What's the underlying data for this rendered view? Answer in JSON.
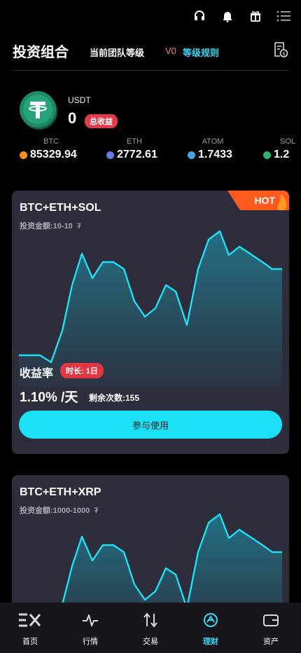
{
  "colors": {
    "accent": "#1ce1f6",
    "badge": "#e23a4b",
    "level_value": "#f08a4b",
    "level_rule": "#38d8f3",
    "card_bg": "#2d2d3b",
    "hot": "#ff5a1e"
  },
  "topbar": {
    "icons": [
      "headset-icon",
      "bell-icon",
      "gift-icon",
      "menu-icon"
    ]
  },
  "header": {
    "title": "投资组合",
    "level_label": "当前团队等级",
    "level_value": "V0",
    "level_rule": "等级规则"
  },
  "summary": {
    "currency": "USDT",
    "total": "0",
    "total_badge": "总收益"
  },
  "prices": [
    {
      "symbol": "BTC",
      "value": "85329.94",
      "color": "#f7931a"
    },
    {
      "symbol": "ETH",
      "value": "2772.61",
      "color": "#627eea"
    },
    {
      "symbol": "ATOM",
      "value": "1.7433",
      "color": "#4aa3df"
    },
    {
      "symbol": "SOL",
      "value": "1.2",
      "color": "#2bb673"
    }
  ],
  "cards": [
    {
      "name": "BTC+ETH+SOL",
      "amount": "投资金额:10-10",
      "amount_unit": "₮",
      "hot": "HOT",
      "yield_label": "收益率",
      "duration": "时长: 1日",
      "rate": "1.10% /天",
      "remaining": "剩余次数:155",
      "button": "参与使用"
    },
    {
      "name": "BTC+ETH+XRP",
      "amount": "投资金额:1000-1000",
      "amount_unit": "₮"
    }
  ],
  "nav": [
    {
      "label": "首页",
      "icon": "home-logo-icon"
    },
    {
      "label": "行情",
      "icon": "pulse-icon"
    },
    {
      "label": "交易",
      "icon": "swap-arrows-icon"
    },
    {
      "label": "理财",
      "icon": "finance-icon",
      "active": true
    },
    {
      "label": "资产",
      "icon": "wallet-icon"
    }
  ]
}
